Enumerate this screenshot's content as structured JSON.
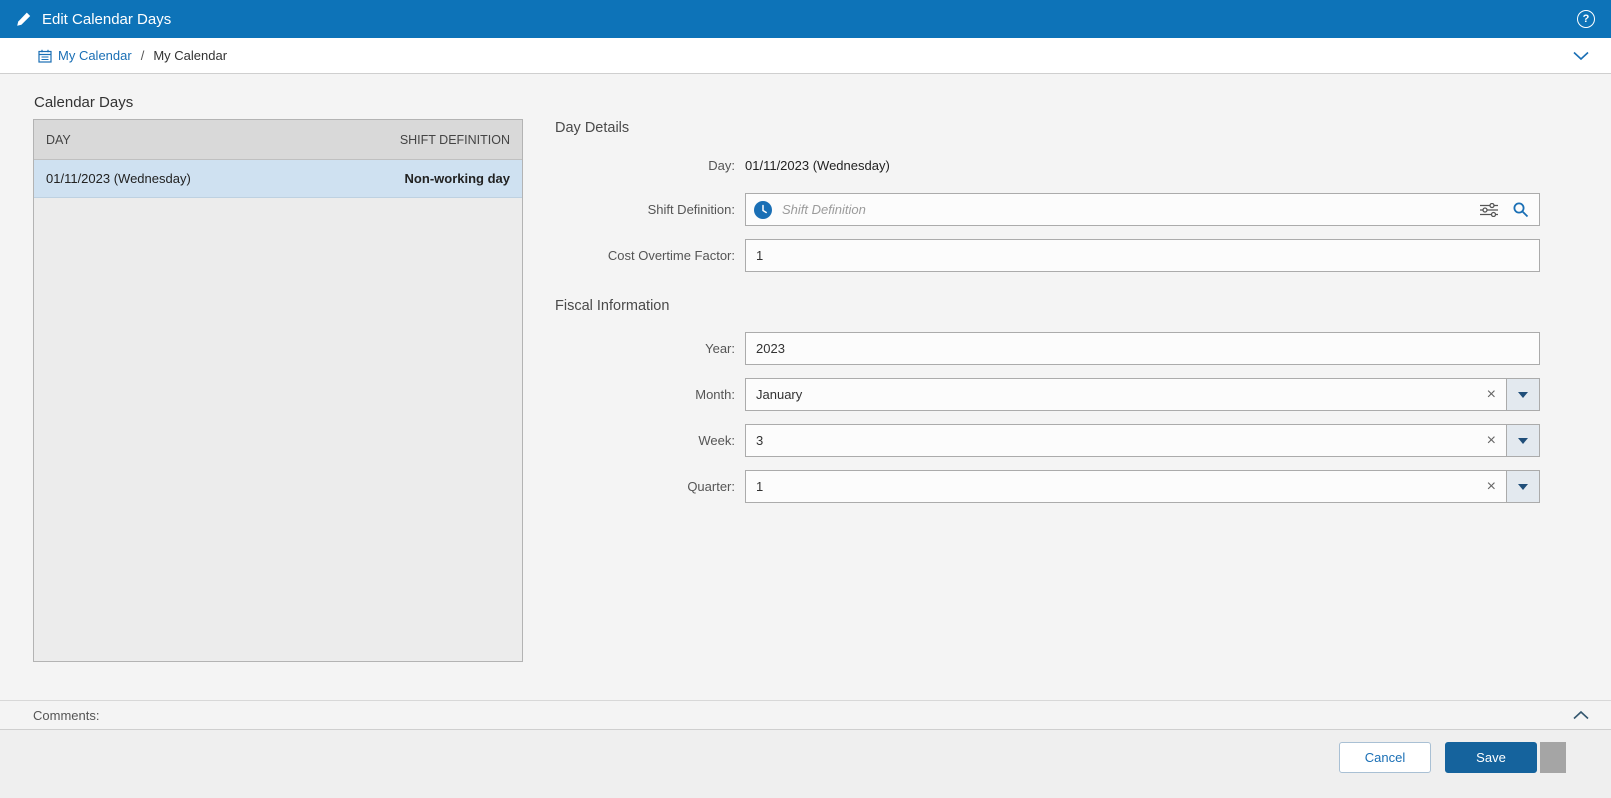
{
  "titlebar": {
    "title": "Edit Calendar Days"
  },
  "breadcrumb": {
    "link": "My Calendar",
    "separator": "/",
    "current": "My Calendar"
  },
  "panel": {
    "title": "Calendar Days"
  },
  "table": {
    "col_day": "DAY",
    "col_shift": "SHIFT DEFINITION",
    "rows": [
      {
        "day": "01/11/2023 (Wednesday)",
        "shift": "Non-working day"
      }
    ]
  },
  "details": {
    "title": "Day Details",
    "day_label": "Day:",
    "day_value": "01/11/2023 (Wednesday)",
    "shift_label": "Shift Definition:",
    "shift_placeholder": "Shift Definition",
    "cost_label": "Cost Overtime Factor:",
    "cost_value": "1"
  },
  "fiscal": {
    "title": "Fiscal Information",
    "year_label": "Year:",
    "year_value": "2023",
    "month_label": "Month:",
    "month_value": "January",
    "week_label": "Week:",
    "week_value": "3",
    "quarter_label": "Quarter:",
    "quarter_value": "1"
  },
  "comments": {
    "label": "Comments:"
  },
  "footer": {
    "cancel_label": "Cancel",
    "save_label": "Save"
  },
  "icons": {
    "help": "?",
    "clear": "×"
  },
  "colors": {
    "header_blue": "#0d73b8",
    "accent_blue": "#1a6fb5",
    "save_blue": "#15639d",
    "selected_row": "#cfe1f1",
    "table_header": "#d9d9d9"
  }
}
